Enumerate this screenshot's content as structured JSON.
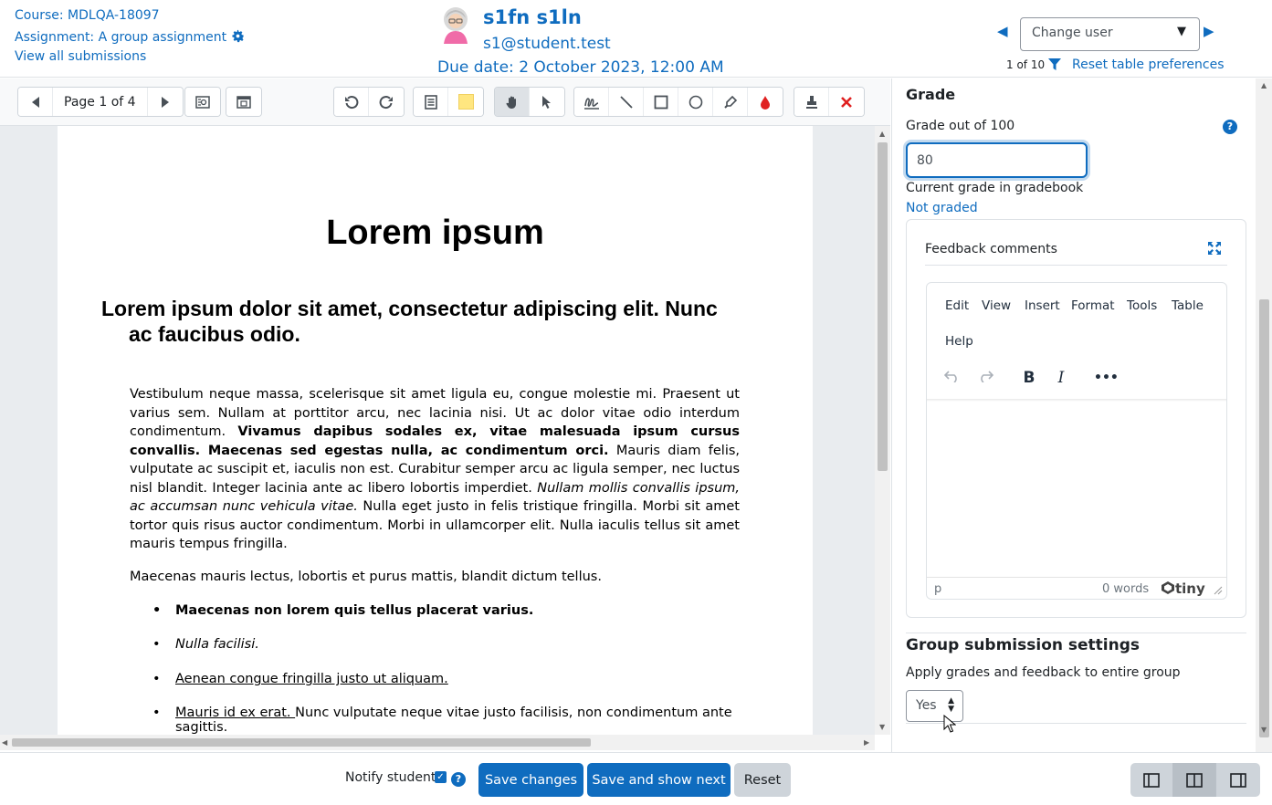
{
  "header": {
    "course": "Course: MDLQA-18097",
    "assignment": "Assignment: A group assignment",
    "view_all": "View all submissions",
    "user_name": "s1fn s1ln",
    "user_email": "s1@student.test",
    "due_date": "Due date: 2 October 2023, 12:00 AM",
    "change_user_placeholder": "Change user",
    "user_count": "1 of 10",
    "reset_prefs": "Reset table preferences"
  },
  "toolbar": {
    "page_label": "Page 1 of 4"
  },
  "document": {
    "title": "Lorem ipsum",
    "heading": "Lorem ipsum dolor sit amet, consectetur adipiscing elit. Nunc ac faucibus odio.",
    "para1_a": "Vestibulum neque massa, scelerisque sit amet ligula eu, congue molestie mi. Praesent ut varius sem. Nullam at porttitor arcu, nec lacinia nisi. Ut ac dolor vitae odio interdum condimentum. ",
    "para1_b": "Vivamus dapibus sodales ex, vitae malesuada ipsum cursus convallis. Maecenas sed egestas nulla, ac condimentum orci.",
    "para1_c": " Mauris diam felis, vulputate ac suscipit et, iaculis non est. Curabitur semper arcu ac ligula semper, nec luctus nisl blandit. Integer lacinia ante ac libero lobortis imperdiet. ",
    "para1_d": "Nullam mollis convallis ipsum, ac accumsan nunc vehicula vitae.",
    "para1_e": " Nulla eget justo in felis tristique fringilla. Morbi sit amet tortor quis risus auctor condimentum. Morbi in ullamcorper elit. Nulla iaculis tellus sit amet mauris tempus fringilla.",
    "para2": "Maecenas mauris lectus, lobortis et purus mattis, blandit dictum tellus.",
    "li1": "Maecenas non lorem quis tellus placerat varius.",
    "li2": "Nulla facilisi.",
    "li3": "Aenean congue fringilla justo ut aliquam. ",
    "li4_a": "Mauris id ex erat. ",
    "li4_b": "Nunc vulputate neque vitae justo facilisis, non condimentum ante sagittis."
  },
  "grade_panel": {
    "heading": "Grade",
    "grade_out_of": "Grade out of 100",
    "grade_value": "80",
    "current_grade_label": "Current grade in gradebook",
    "not_graded": "Not graded",
    "feedback_label": "Feedback comments",
    "editor": {
      "menu": [
        "Edit",
        "View",
        "Insert",
        "Format",
        "Tools",
        "Table",
        "Help"
      ],
      "path": "p",
      "words": "0 words",
      "brand": "tiny"
    },
    "group_heading": "Group submission settings",
    "group_apply": "Apply grades and feedback to entire group",
    "group_select_value": "Yes"
  },
  "footer": {
    "notify_label": "Notify student",
    "notify_checked": true,
    "save_changes": "Save changes",
    "save_next": "Save and show next",
    "reset": "Reset"
  },
  "colors": {
    "primary": "#0f6cbf",
    "annotate_red": "#e02020",
    "sticky_yellow": "#ffe680"
  }
}
